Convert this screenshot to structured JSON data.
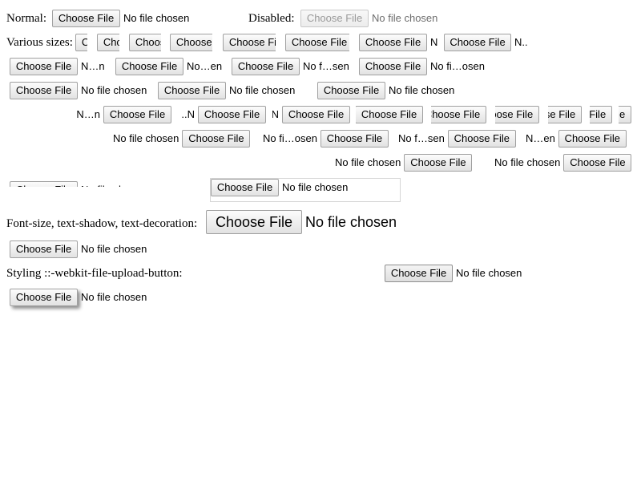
{
  "labels": {
    "normal": "Normal:",
    "disabled": "Disabled:",
    "sizes": "Various sizes:",
    "font": "Font-size, text-shadow, text-decoration:",
    "styling": "Styling ::-webkit-file-upload-button:"
  },
  "button_label": "Choose File",
  "no_file": "No file chosen",
  "truncated": {
    "nn": "N…n",
    "noen": "No…en",
    "nofsen": "No f…sen",
    "nofiosen": "No fi…osen",
    "nfiosen": "No fi…osen",
    "nfsen": "No f…sen",
    "nsen": "N…en",
    "ndot": "N..",
    "n": "N",
    "dots": "..N"
  }
}
